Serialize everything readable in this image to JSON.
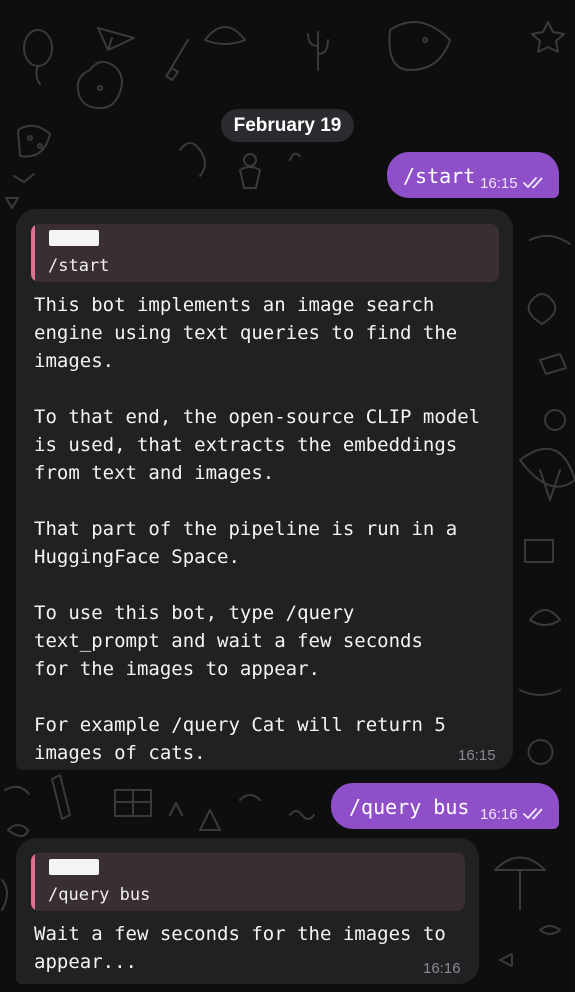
{
  "chat": {
    "date_label": "February 19",
    "colors": {
      "outgoing_bubble": "#8e4fc8",
      "incoming_bubble": "#212124",
      "reply_bar": "#e0708f",
      "background": "#0e0e0f"
    },
    "messages": [
      {
        "direction": "outgoing",
        "text": "/start",
        "time": "16:15",
        "status": "read-double-check-icon"
      },
      {
        "direction": "incoming",
        "reply_to": {
          "text": "/start"
        },
        "text": "This bot implements an image search\nengine using text queries to find the\nimages.\n\nTo that end, the open-source CLIP model\nis used, that extracts the embeddings\nfrom text and images.\n\nThat part of the pipeline is run in a\nHuggingFace Space.\n\nTo use this bot, type /query\ntext_prompt and wait a few seconds\nfor the images to appear.\n\nFor example /query Cat will return 5\nimages of cats.",
        "time": "16:15"
      },
      {
        "direction": "outgoing",
        "text": "/query bus",
        "time": "16:16",
        "status": "read-double-check-icon"
      },
      {
        "direction": "incoming",
        "reply_to": {
          "text": "/query bus"
        },
        "text": "Wait a few seconds for the images to\nappear...",
        "time": "16:16"
      }
    ]
  }
}
